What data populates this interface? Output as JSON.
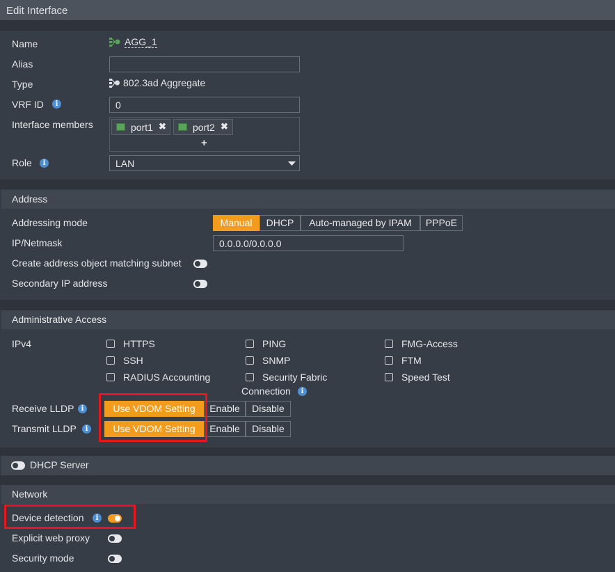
{
  "window": {
    "title": "Edit Interface"
  },
  "general": {
    "name_label": "Name",
    "name_value": "AGG_1",
    "alias_label": "Alias",
    "alias_value": "",
    "type_label": "Type",
    "type_value": "802.3ad Aggregate",
    "vrf_label": "VRF ID",
    "vrf_value": "0",
    "members_label": "Interface members",
    "members": [
      {
        "label": "port1"
      },
      {
        "label": "port2"
      }
    ],
    "add_member": "+",
    "role_label": "Role",
    "role_value": "LAN"
  },
  "address": {
    "header": "Address",
    "mode_label": "Addressing mode",
    "modes": [
      "Manual",
      "DHCP",
      "Auto-managed by IPAM",
      "PPPoE"
    ],
    "active_mode": "Manual",
    "ipmask_label": "IP/Netmask",
    "ipmask_value": "0.0.0.0/0.0.0.0",
    "create_obj_label": "Create address object matching subnet",
    "create_obj_on": false,
    "secondary_label": "Secondary IP address",
    "secondary_on": false
  },
  "admin": {
    "header": "Administrative Access",
    "ipv4_label": "IPv4",
    "col1": [
      "HTTPS",
      "SSH",
      "RADIUS Accounting"
    ],
    "col2": [
      "PING",
      "SNMP",
      "Security Fabric"
    ],
    "col2_extra": "Connection",
    "col3": [
      "FMG-Access",
      "FTM",
      "Speed Test"
    ],
    "receive_lldp_label": "Receive LLDP",
    "transmit_lldp_label": "Transmit LLDP",
    "lldp_options": [
      "Use VDOM Setting",
      "Enable",
      "Disable"
    ]
  },
  "dhcp": {
    "label": "DHCP Server",
    "on": false
  },
  "network": {
    "header": "Network",
    "device_detection_label": "Device detection",
    "device_detection_on": true,
    "web_proxy_label": "Explicit web proxy",
    "web_proxy_on": false,
    "security_mode_label": "Security mode",
    "security_mode_on": false
  },
  "colors": {
    "accent": "#f29b1d",
    "highlight": "#e8151d",
    "info": "#4e8ed3",
    "background": "#373d47"
  }
}
